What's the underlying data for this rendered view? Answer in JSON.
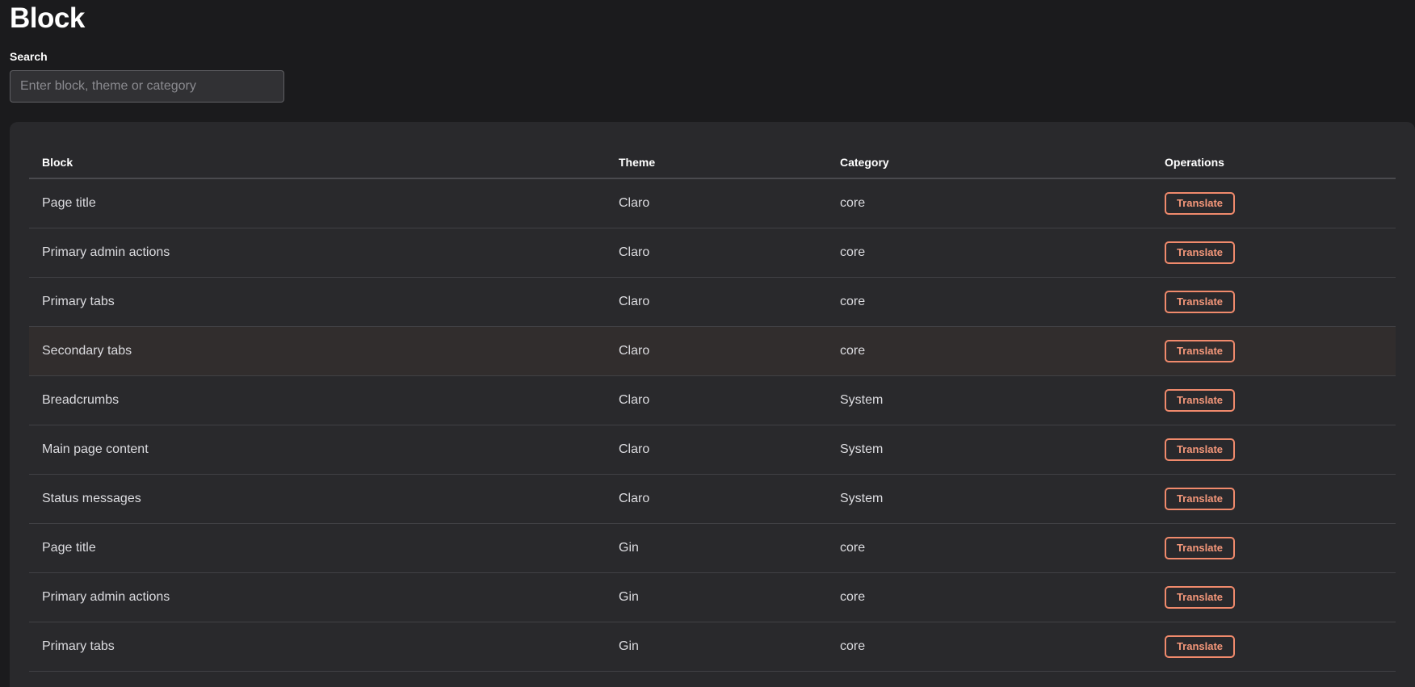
{
  "page": {
    "title": "Block"
  },
  "search": {
    "label": "Search",
    "placeholder": "Enter block, theme or category",
    "value": ""
  },
  "table": {
    "headers": {
      "block": "Block",
      "theme": "Theme",
      "category": "Category",
      "operations": "Operations"
    },
    "rows": [
      {
        "block": "Page title",
        "theme": "Claro",
        "category": "core",
        "action": "Translate"
      },
      {
        "block": "Primary admin actions",
        "theme": "Claro",
        "category": "core",
        "action": "Translate"
      },
      {
        "block": "Primary tabs",
        "theme": "Claro",
        "category": "core",
        "action": "Translate"
      },
      {
        "block": "Secondary tabs",
        "theme": "Claro",
        "category": "core",
        "action": "Translate"
      },
      {
        "block": "Breadcrumbs",
        "theme": "Claro",
        "category": "System",
        "action": "Translate"
      },
      {
        "block": "Main page content",
        "theme": "Claro",
        "category": "System",
        "action": "Translate"
      },
      {
        "block": "Status messages",
        "theme": "Claro",
        "category": "System",
        "action": "Translate"
      },
      {
        "block": "Page title",
        "theme": "Gin",
        "category": "core",
        "action": "Translate"
      },
      {
        "block": "Primary admin actions",
        "theme": "Gin",
        "category": "core",
        "action": "Translate"
      },
      {
        "block": "Primary tabs",
        "theme": "Gin",
        "category": "core",
        "action": "Translate"
      }
    ]
  },
  "colors": {
    "background": "#1b1b1d",
    "card": "#29292c",
    "accent": "#f08a6c",
    "row_highlight": "#312d2d"
  }
}
